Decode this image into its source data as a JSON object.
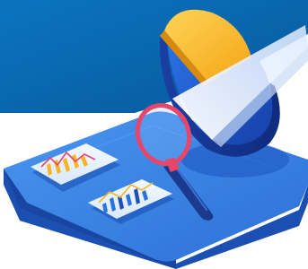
{
  "illustration": {
    "subject": "data-analysis",
    "icons": {
      "pie": "pie-chart-icon",
      "magnifier": "magnifying-glass-icon",
      "line_card": "line-chart-card-icon",
      "bar_card": "bar-chart-card-icon"
    },
    "colors": {
      "banner": "#0a6db6",
      "platform_top": "#3d86e6",
      "platform_side": "#1f57be",
      "pie_blue": "#1f5ed6",
      "pie_yellow": "#f7b526",
      "magnifier_ring": "#e8456a",
      "card": "#e8f2ff",
      "chart_yellow": "#f7b526",
      "chart_blue": "#2a74e0"
    }
  }
}
